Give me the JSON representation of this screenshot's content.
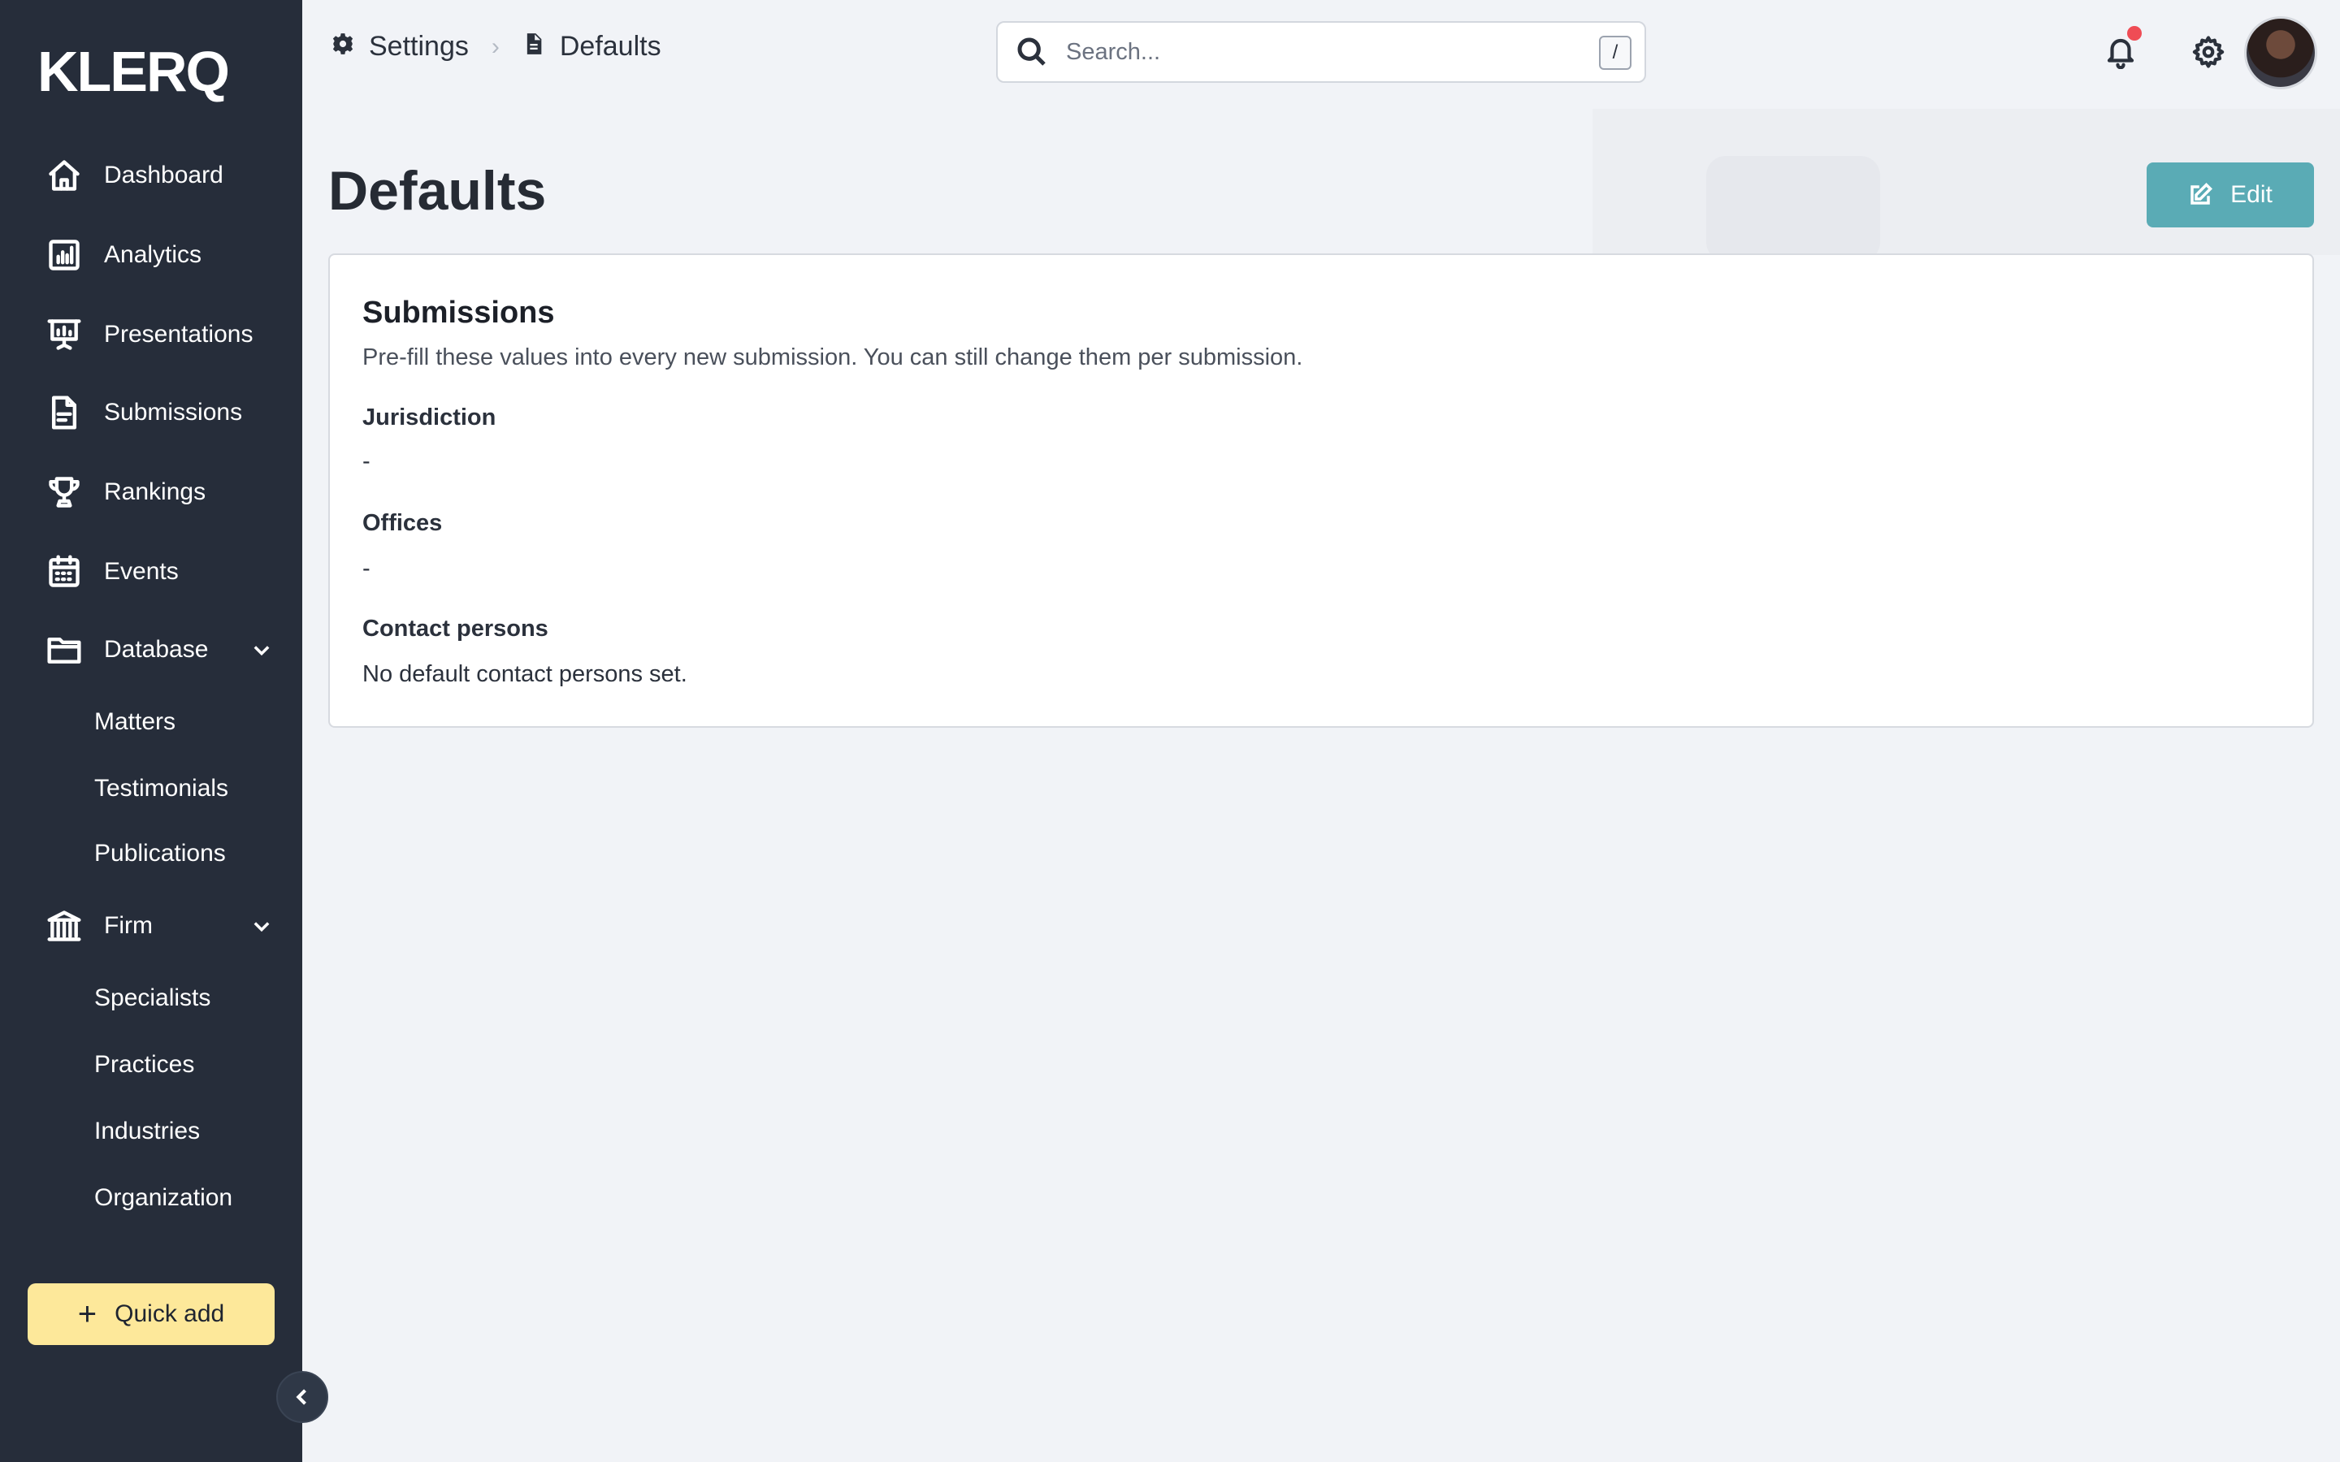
{
  "app": {
    "logo_text": "KLERQ"
  },
  "sidebar": {
    "items": [
      {
        "label": "Dashboard",
        "icon": "home-icon"
      },
      {
        "label": "Analytics",
        "icon": "analytics-icon"
      },
      {
        "label": "Presentations",
        "icon": "presentation-icon"
      },
      {
        "label": "Submissions",
        "icon": "document-icon"
      },
      {
        "label": "Rankings",
        "icon": "trophy-icon"
      },
      {
        "label": "Events",
        "icon": "calendar-icon"
      },
      {
        "label": "Database",
        "icon": "folder-icon",
        "expanded": true
      },
      {
        "label": "Firm",
        "icon": "bank-icon",
        "expanded": true
      }
    ],
    "database_children": [
      "Matters",
      "Testimonials",
      "Publications"
    ],
    "firm_children": [
      "Specialists",
      "Practices",
      "Industries",
      "Organization"
    ],
    "quick_add_label": "Quick add"
  },
  "header": {
    "breadcrumb": [
      {
        "label": "Settings",
        "icon": "gear-icon"
      },
      {
        "label": "Defaults",
        "icon": "file-icon"
      }
    ],
    "search_placeholder": "Search...",
    "search_shortcut": "/",
    "has_notification": true
  },
  "page": {
    "title": "Defaults",
    "edit_label": "Edit"
  },
  "card": {
    "title": "Submissions",
    "description": "Pre-fill these values into every new submission. You can still change them per submission.",
    "fields": [
      {
        "label": "Jurisdiction",
        "value": "-"
      },
      {
        "label": "Offices",
        "value": "-"
      },
      {
        "label": "Contact persons",
        "value": "No default contact persons set."
      }
    ]
  },
  "colors": {
    "sidebar_bg": "#262d3a",
    "accent": "#5aabb5",
    "quick_add_bg": "#fde89a",
    "notification": "#ef4c55"
  }
}
